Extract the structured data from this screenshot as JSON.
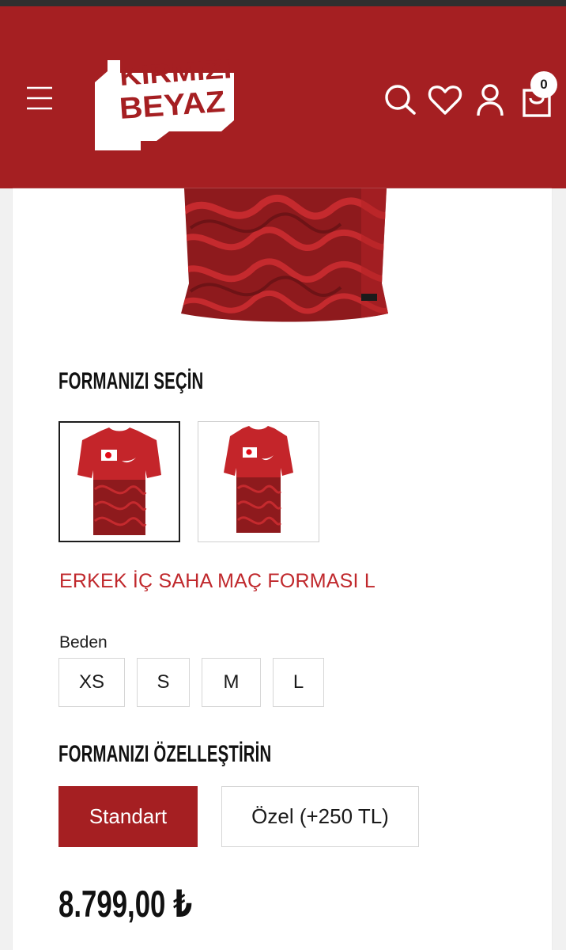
{
  "header": {
    "logo_text_line1": "KIRMIZI",
    "logo_text_line2": "BEYAZ",
    "cart_count": "0",
    "icons": [
      "menu-icon",
      "search-icon",
      "heart-icon",
      "user-icon",
      "shopping-bag-icon"
    ]
  },
  "colors": {
    "brand_red": "#a51f22",
    "accent_text_red": "#c0282c",
    "header_bar": "#2f2f2f"
  },
  "jersey_select": {
    "title": "FORMANIZI SEÇİN",
    "options_count": 2,
    "selected_index": 0
  },
  "product": {
    "variant_name": "ERKEK İÇ SAHA MAÇ FORMASI L"
  },
  "size": {
    "label": "Beden",
    "options": [
      "XS",
      "S",
      "M",
      "L"
    ]
  },
  "customize": {
    "title": "FORMANIZI ÖZELLEŞTİRİN",
    "options": [
      "Standart",
      "Özel (+250 TL)"
    ],
    "selected": "Standart"
  },
  "price": {
    "amount": "8.799,00",
    "currency": "₺"
  }
}
